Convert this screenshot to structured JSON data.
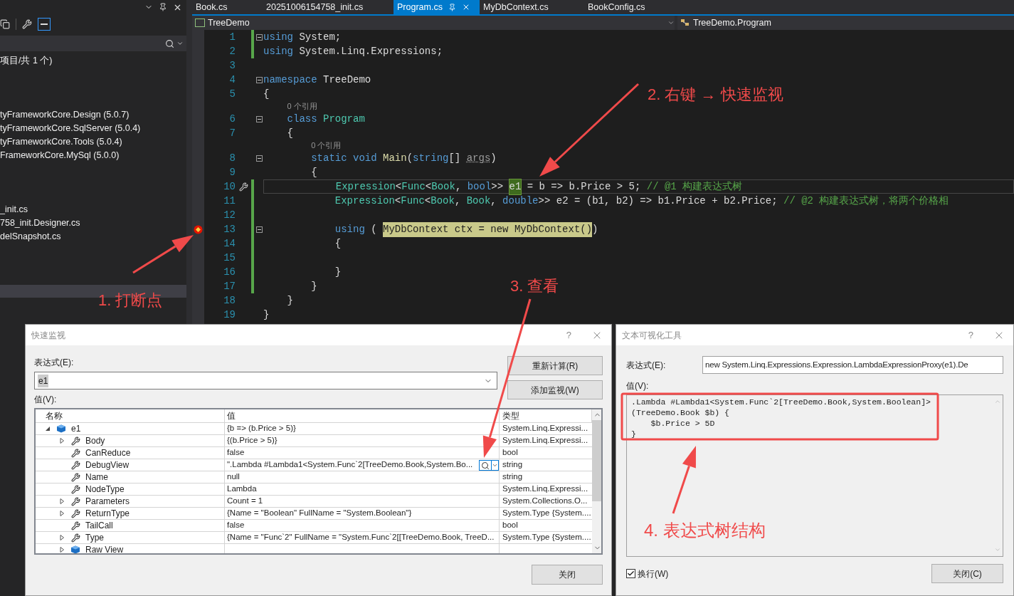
{
  "solution_explorer": {
    "summary": "项目/共 1 个)",
    "groups": [
      {
        "items": [
          "tyFrameworkCore.Design (5.0.7)",
          "tyFrameworkCore.SqlServer (5.0.4)",
          "tyFrameworkCore.Tools (5.0.4)",
          "FrameworkCore.MySql (5.0.0)"
        ]
      },
      {
        "items": [
          "_init.cs",
          "758_init.Designer.cs",
          "delSnapshot.cs"
        ]
      }
    ]
  },
  "tabs": [
    {
      "label": "Book.cs",
      "selected": false
    },
    {
      "label": "20251006154758_init.cs",
      "selected": false
    },
    {
      "label": "Program.cs",
      "selected": true
    },
    {
      "label": "MyDbContext.cs",
      "selected": false
    },
    {
      "label": "BookConfig.cs",
      "selected": false
    }
  ],
  "navigation": {
    "project": "TreeDemo",
    "member": "TreeDemo.Program"
  },
  "editor": {
    "lines": [
      {
        "kind": "code",
        "number": "1",
        "fold": true,
        "changed": true,
        "tokens": [
          {
            "kind": "kw",
            "text": "using"
          },
          {
            "kind": "plain",
            "text": " System;"
          }
        ]
      },
      {
        "kind": "code",
        "number": "2",
        "changed": true,
        "tokens": [
          {
            "kind": "kw",
            "text": "using"
          },
          {
            "kind": "plain",
            "text": " System.Linq.Expressions;"
          }
        ]
      },
      {
        "kind": "code",
        "number": "3"
      },
      {
        "kind": "code",
        "number": "4",
        "fold": true,
        "tokens": [
          {
            "kind": "kw",
            "text": "namespace"
          },
          {
            "kind": "plain",
            "text": " TreeDemo"
          }
        ]
      },
      {
        "kind": "code",
        "number": "5",
        "tokens": [
          {
            "kind": "plain",
            "text": "{"
          }
        ]
      },
      {
        "kind": "lens",
        "text": "0 个引用"
      },
      {
        "kind": "code",
        "number": "6",
        "fold": true,
        "tokens": [
          {
            "kind": "kw",
            "text": "    class "
          },
          {
            "kind": "type",
            "text": "Program"
          }
        ]
      },
      {
        "kind": "code",
        "number": "7",
        "tokens": [
          {
            "kind": "plain",
            "text": "    {"
          }
        ]
      },
      {
        "kind": "lens",
        "text": "0 个引用"
      },
      {
        "kind": "code",
        "number": "8",
        "fold": true,
        "tokens": [
          {
            "kind": "kw",
            "text": "        static void "
          },
          {
            "kind": "method",
            "text": "Main"
          },
          {
            "kind": "plain",
            "text": "("
          },
          {
            "kind": "kw",
            "text": "string"
          },
          {
            "kind": "plain",
            "text": "[] "
          },
          {
            "kind": "unused",
            "text": "args"
          },
          {
            "kind": "plain",
            "text": ")"
          }
        ]
      },
      {
        "kind": "code",
        "number": "9",
        "tokens": [
          {
            "kind": "plain",
            "text": "        {"
          }
        ]
      },
      {
        "kind": "code",
        "number": "10",
        "changed": true,
        "current": true,
        "quick_action": true,
        "tokens": [
          {
            "kind": "type",
            "text": "            Expression"
          },
          {
            "kind": "plain",
            "text": "<"
          },
          {
            "kind": "type",
            "text": "Func"
          },
          {
            "kind": "plain",
            "text": "<"
          },
          {
            "kind": "type",
            "text": "Book"
          },
          {
            "kind": "plain",
            "text": ", "
          },
          {
            "kind": "kw",
            "text": "bool"
          },
          {
            "kind": "plain",
            "text": ">> "
          },
          {
            "kind": "ref",
            "text": "e1"
          },
          {
            "kind": "plain",
            "text": " = b => b.Price > 5; "
          },
          {
            "kind": "comment",
            "text": "// @1 构建表达式树"
          }
        ]
      },
      {
        "kind": "code",
        "number": "11",
        "changed": true,
        "tokens": [
          {
            "kind": "type",
            "text": "            Expression"
          },
          {
            "kind": "plain",
            "text": "<"
          },
          {
            "kind": "type",
            "text": "Func"
          },
          {
            "kind": "plain",
            "text": "<"
          },
          {
            "kind": "type",
            "text": "Book"
          },
          {
            "kind": "plain",
            "text": ", "
          },
          {
            "kind": "type",
            "text": "Book"
          },
          {
            "kind": "plain",
            "text": ", "
          },
          {
            "kind": "kw",
            "text": "double"
          },
          {
            "kind": "plain",
            "text": ">> e2 = (b1, b2) => b1.Price + b2.Price; "
          },
          {
            "kind": "comment",
            "text": "// @2 构建表达式树，将两个价格相"
          }
        ]
      },
      {
        "kind": "code",
        "number": "12",
        "changed": true
      },
      {
        "kind": "code",
        "number": "13",
        "fold": true,
        "changed": true,
        "breakpoint": true,
        "tokens": [
          {
            "kind": "kw",
            "text": "            using"
          },
          {
            "kind": "plain",
            "text": " ( "
          },
          {
            "kind": "hl",
            "text": "MyDbContext ctx = new MyDbContext()"
          },
          {
            "kind": "plain",
            "text": ")"
          }
        ]
      },
      {
        "kind": "code",
        "number": "14",
        "changed": true,
        "tokens": [
          {
            "kind": "plain",
            "text": "            {"
          }
        ]
      },
      {
        "kind": "code",
        "number": "15",
        "changed": true
      },
      {
        "kind": "code",
        "number": "16",
        "changed": true,
        "tokens": [
          {
            "kind": "plain",
            "text": "            }"
          }
        ]
      },
      {
        "kind": "code",
        "number": "17",
        "changed": true,
        "tokens": [
          {
            "kind": "plain",
            "text": "        }"
          }
        ]
      },
      {
        "kind": "code",
        "number": "18",
        "tokens": [
          {
            "kind": "plain",
            "text": "    }"
          }
        ]
      },
      {
        "kind": "code",
        "number": "19",
        "tokens": [
          {
            "kind": "plain",
            "text": "}"
          }
        ]
      }
    ]
  },
  "quick_watch": {
    "title": "快速监视",
    "help": "?",
    "expression_label": "表达式(E):",
    "expression": "e1",
    "value_label": "值(V):",
    "buttons": [
      "重新计算(R)",
      "添加监视(W)"
    ],
    "columns": [
      "名称",
      "值",
      "类型"
    ],
    "rows": [
      {
        "name": "e1",
        "value": "{b => (b.Price > 5)}",
        "type": "System.Linq.Expressi...",
        "kind": "object",
        "expandable": true,
        "expanded": true,
        "children": [
          {
            "name": "Body",
            "value": "{(b.Price > 5)}",
            "type": "System.Linq.Expressi...",
            "kind": "property",
            "expandable": true,
            "expanded": false
          },
          {
            "name": "CanReduce",
            "value": "false",
            "type": "bool",
            "kind": "property",
            "expandable": false,
            "expanded": false
          },
          {
            "name": "DebugView",
            "value": "\".Lambda #Lambda1<System.Func`2[TreeDemo.Book,System.Bo...",
            "type": "string",
            "kind": "property",
            "expandable": false,
            "expanded": false,
            "visualizer": true
          },
          {
            "name": "Name",
            "value": "null",
            "type": "string",
            "kind": "property",
            "expandable": false,
            "expanded": false
          },
          {
            "name": "NodeType",
            "value": "Lambda",
            "type": "System.Linq.Expressi...",
            "kind": "property",
            "expandable": false,
            "expanded": false
          },
          {
            "name": "Parameters",
            "value": "Count = 1",
            "type": "System.Collections.O...",
            "kind": "property",
            "expandable": true,
            "expanded": false
          },
          {
            "name": "ReturnType",
            "value": "{Name = \"Boolean\" FullName = \"System.Boolean\"}",
            "type": "System.Type {System....",
            "kind": "property",
            "expandable": true,
            "expanded": false
          },
          {
            "name": "TailCall",
            "value": "false",
            "type": "bool",
            "kind": "property",
            "expandable": false,
            "expanded": false
          },
          {
            "name": "Type",
            "value": "{Name = \"Func`2\" FullName = \"System.Func`2[[TreeDemo.Book, TreeD...",
            "type": "System.Type {System....",
            "kind": "property",
            "expandable": true,
            "expanded": false
          },
          {
            "name": "Raw View",
            "kind": "object",
            "expandable": true,
            "expanded": false
          }
        ]
      }
    ],
    "close_button": "关闭"
  },
  "visualizer": {
    "title": "文本可视化工具",
    "help": "?",
    "expression_label": "表达式(E):",
    "expression": "new System.Linq.Expressions.Expression.LambdaExpressionProxy(e1).De",
    "value_label": "值(V):",
    "value_lines": [
      ".Lambda #Lambda1<System.Func`2[TreeDemo.Book,System.Boolean]>",
      "(TreeDemo.Book $b) {",
      "    $b.Price > 5D",
      "}"
    ],
    "wrap": {
      "label": "换行(W)",
      "checked": true
    },
    "close_button": "关闭(C)"
  },
  "annotations": [
    {
      "text": "1. 打断点"
    },
    {
      "text": "2. 右键 → 快速监视"
    },
    {
      "text": "3. 查看"
    },
    {
      "text": "4. 表达式树结构"
    }
  ]
}
